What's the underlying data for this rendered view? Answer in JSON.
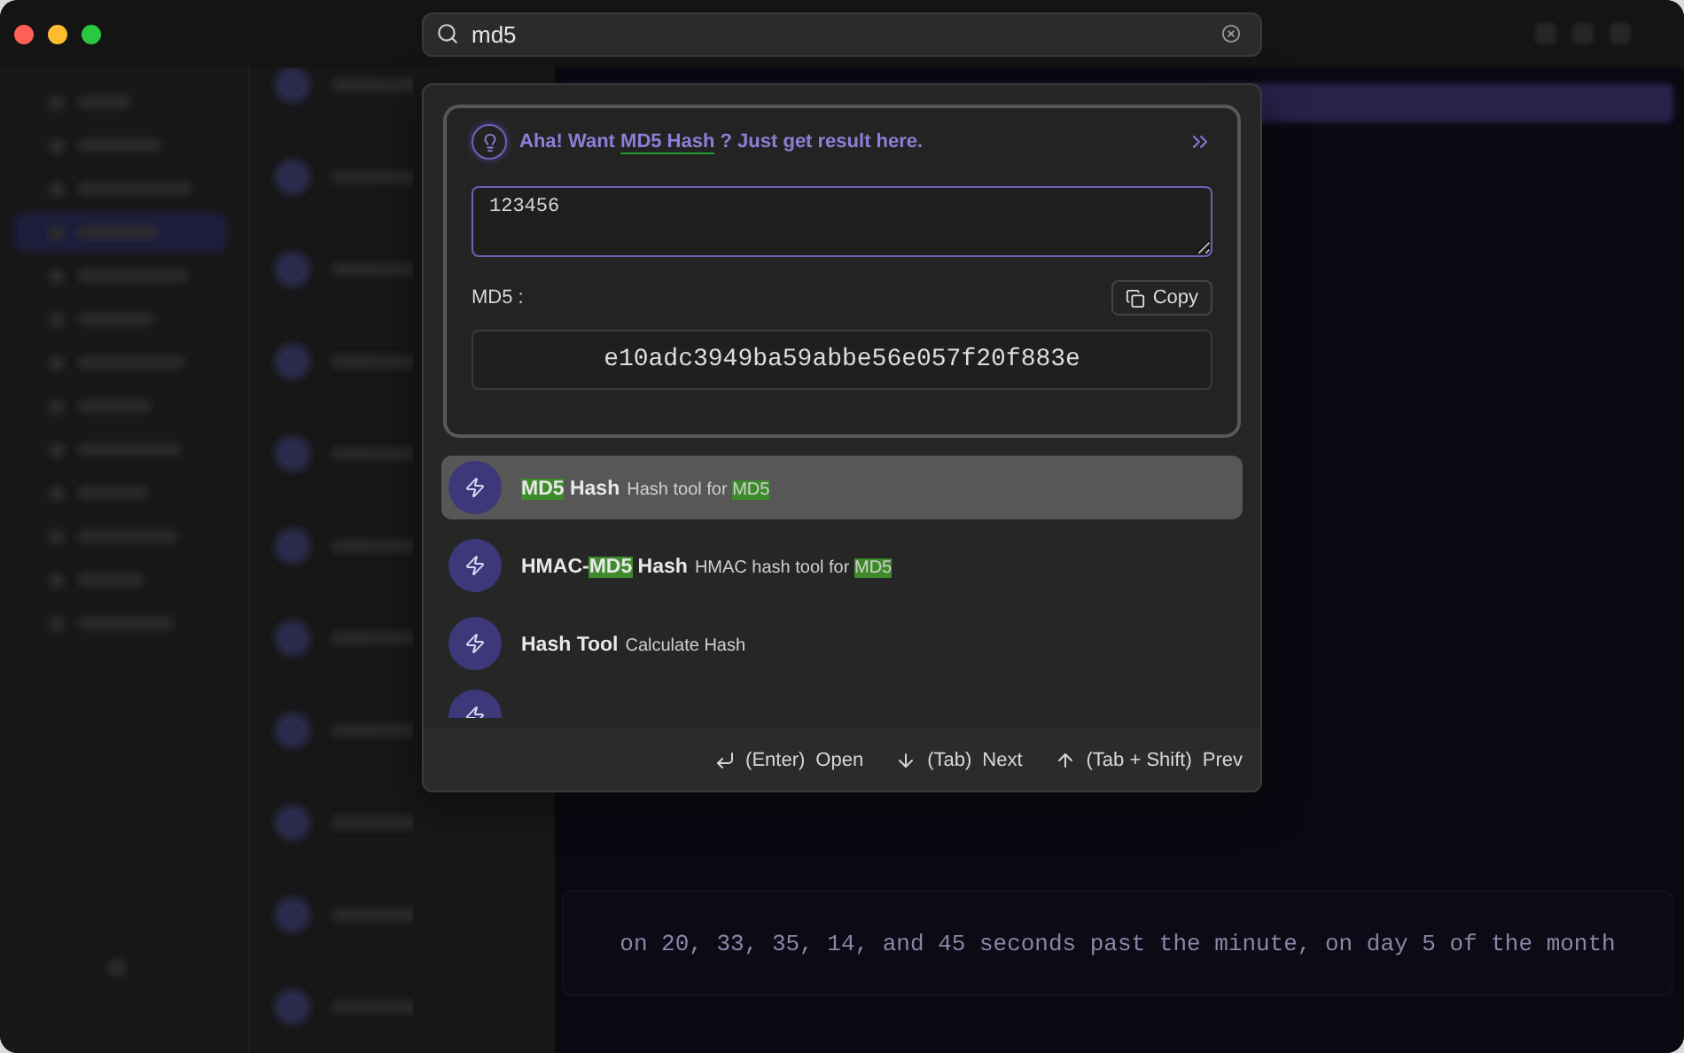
{
  "search": {
    "value": "md5"
  },
  "hint": {
    "before": "Aha! Want ",
    "link": "MD5 Hash",
    "after": " ? Just get result here."
  },
  "input": {
    "value": "123456"
  },
  "output": {
    "label": "MD5 :",
    "copy_label": "Copy",
    "value": "e10adc3949ba59abbe56e057f20f883e"
  },
  "results": [
    {
      "kind": "tool",
      "selected": true,
      "title": [
        {
          "text": "MD5",
          "highlighted": true
        },
        {
          "text": " Hash",
          "highlighted": false
        }
      ],
      "description": [
        {
          "text": "Hash tool for ",
          "highlighted": false
        },
        {
          "text": "MD5",
          "highlighted": true
        }
      ]
    },
    {
      "kind": "tool",
      "selected": false,
      "title": [
        {
          "text": "HMAC-",
          "highlighted": false
        },
        {
          "text": "MD5",
          "highlighted": true
        },
        {
          "text": " Hash",
          "highlighted": false
        }
      ],
      "description": [
        {
          "text": "HMAC hash tool for ",
          "highlighted": false
        },
        {
          "text": "MD5",
          "highlighted": true
        }
      ]
    },
    {
      "kind": "tool",
      "selected": false,
      "title": [
        {
          "text": "Hash Tool",
          "highlighted": false
        }
      ],
      "description": [
        {
          "text": "Calculate Hash",
          "highlighted": false
        }
      ]
    },
    {
      "kind": "clipped",
      "selected": false
    }
  ],
  "shortcuts": [
    {
      "kind": "enter",
      "key": "(Enter)",
      "action": "Open"
    },
    {
      "kind": "down",
      "key": "(Tab)",
      "action": "Next"
    },
    {
      "kind": "up",
      "key": "(Tab + Shift)",
      "action": "Prev"
    }
  ],
  "background_text": "on 20, 33, 35, 14, and 45 seconds past the minute, on day 5 of the month"
}
